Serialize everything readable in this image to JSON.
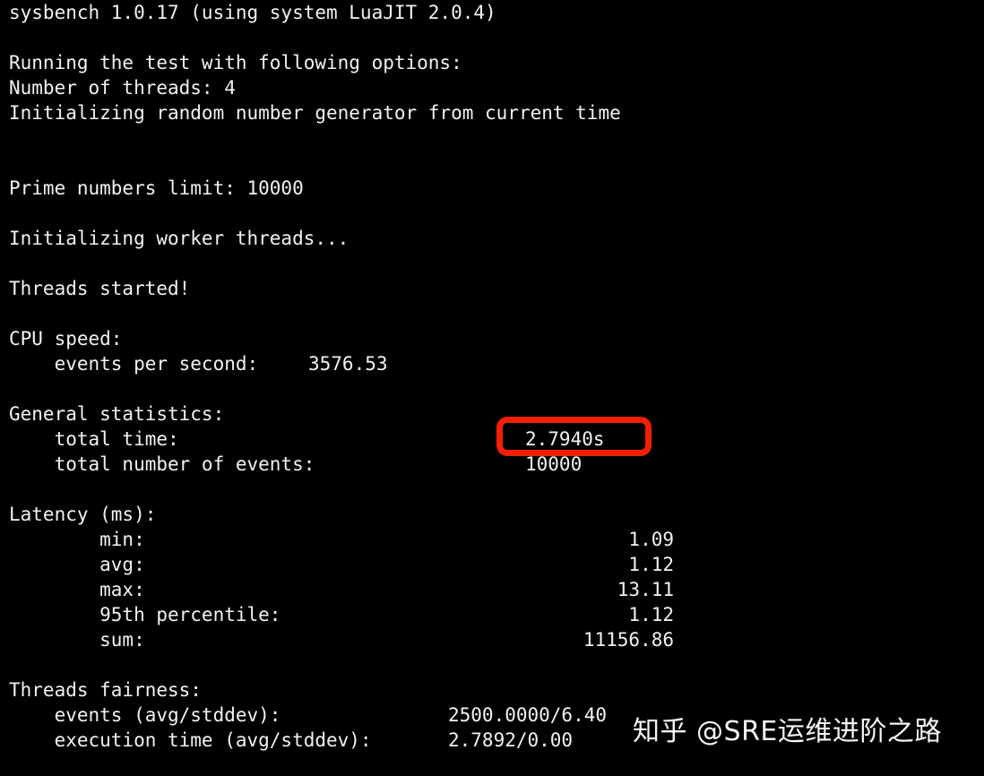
{
  "terminal": {
    "background_color": "#000000",
    "text_color": "#f2f2f2",
    "header": "sysbench 1.0.17 (using system LuaJIT 2.0.4)",
    "run_header": "Running the test with following options:",
    "threads_line": "Number of threads: 4",
    "rng_line": "Initializing random number generator from current time",
    "prime_limit_line": "Prime numbers limit: 10000",
    "init_workers_line": "Initializing worker threads...",
    "threads_started_line": "Threads started!",
    "cpu_speed": {
      "heading": "CPU speed:",
      "events_per_second_label": "    events per second:",
      "events_per_second_value": "3576.53"
    },
    "general_statistics": {
      "heading": "General statistics:",
      "total_time_label": "    total time:",
      "total_time_value": "2.7940s",
      "total_events_label": "    total number of events:",
      "total_events_value": "10000"
    },
    "latency": {
      "heading": "Latency (ms):",
      "rows": [
        {
          "label": "        min:",
          "value": "1.09"
        },
        {
          "label": "        avg:",
          "value": "1.12"
        },
        {
          "label": "        max:",
          "value": "13.11"
        },
        {
          "label": "        95th percentile:",
          "value": "1.12"
        },
        {
          "label": "        sum:",
          "value": "11156.86"
        }
      ]
    },
    "threads_fairness": {
      "heading": "Threads fairness:",
      "rows": [
        {
          "label": "    events (avg/stddev):",
          "value": "2500.0000/6.40"
        },
        {
          "label": "    execution time (avg/stddev):",
          "value": "2.7892/0.00"
        }
      ]
    }
  },
  "annotation": {
    "highlight_color": "#f22000",
    "highlighted_value": "2.7940s"
  },
  "watermark": {
    "text": "知乎 @SRE运维进阶之路"
  }
}
